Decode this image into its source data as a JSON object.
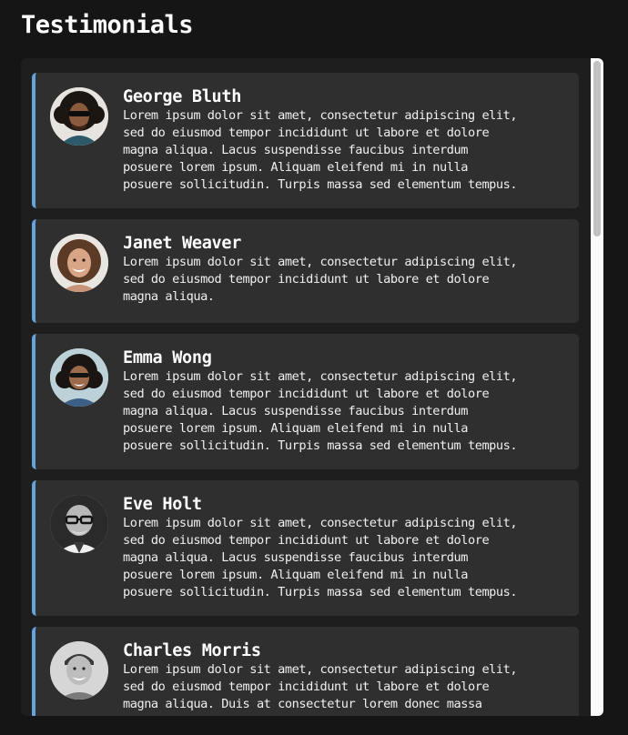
{
  "page": {
    "title": "Testimonials"
  },
  "testimonials": [
    {
      "name": "George Bluth",
      "text": "Lorem ipsum dolor sit amet, consectetur adipiscing elit,\nsed do eiusmod tempor incididunt ut labore et dolore\nmagna aliqua. Lacus suspendisse faucibus interdum\nposuere lorem ipsum. Aliquam eleifend mi in nulla\nposuere sollicitudin. Turpis massa sed elementum tempus.",
      "avatar": "man-curly-hair-sunglasses"
    },
    {
      "name": "Janet Weaver",
      "text": "Lorem ipsum dolor sit amet, consectetur adipiscing elit,\nsed do eiusmod tempor incididunt ut labore et dolore\nmagna aliqua.",
      "avatar": "woman-curly-hair-smiling"
    },
    {
      "name": "Emma Wong",
      "text": "Lorem ipsum dolor sit amet, consectetur adipiscing elit,\nsed do eiusmod tempor incididunt ut labore et dolore\nmagna aliqua. Lacus suspendisse faucibus interdum\nposuere lorem ipsum. Aliquam eleifend mi in nulla\nposuere sollicitudin. Turpis massa sed elementum tempus.",
      "avatar": "woman-curly-hair-sunglasses"
    },
    {
      "name": "Eve Holt",
      "text": "Lorem ipsum dolor sit amet, consectetur adipiscing elit,\nsed do eiusmod tempor incididunt ut labore et dolore\nmagna aliqua. Lacus suspendisse faucibus interdum\nposuere lorem ipsum. Aliquam eleifend mi in nulla\nposuere sollicitudin. Turpis massa sed elementum tempus.",
      "avatar": "bald-man-glasses-grayscale"
    },
    {
      "name": "Charles Morris",
      "text": "Lorem ipsum dolor sit amet, consectetur adipiscing elit,\nsed do eiusmod tempor incididunt ut labore et dolore\nmagna aliqua. Duis at consectetur lorem donec massa",
      "avatar": "smiling-man-grayscale"
    }
  ],
  "colors": {
    "background": "#151515",
    "panel": "#1e1e1e",
    "card": "#2f2f2f",
    "accent": "#66a3dc"
  }
}
